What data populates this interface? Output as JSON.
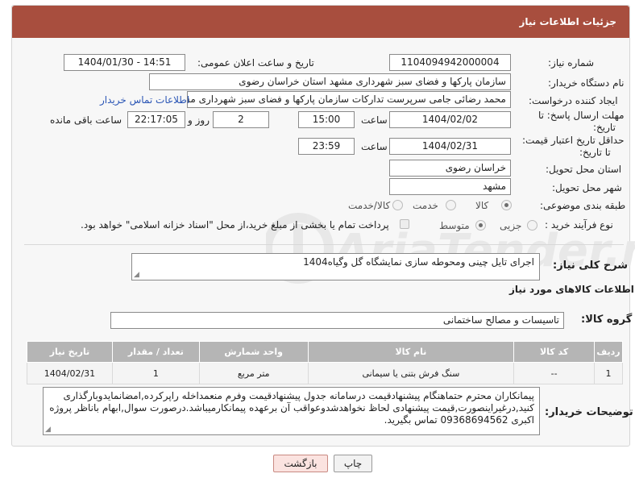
{
  "header": {
    "title": "جزئیات اطلاعات نیاز"
  },
  "fields": {
    "need_number": {
      "label": "شماره نیاز:",
      "value": "1104094942000004"
    },
    "announce_date": {
      "label": "تاریخ و ساعت اعلان عمومی:",
      "value": "1404/01/30 - 14:51"
    },
    "buyer_org": {
      "label": "نام دستگاه خریدار:",
      "value": "سازمان پارکها و فضای سبز شهرداری مشهد استان خراسان رضوی"
    },
    "creator": {
      "label": "ایجاد کننده درخواست:",
      "value": "محمد رضائی جامی سرپرست تدارکات سازمان پارکها و فضای سبز شهرداری مش",
      "contact_link": "اطلاعات تماس خریدار"
    },
    "deadline": {
      "label_line1": "مهلت ارسال پاسخ: تا",
      "label_line2": "تاریخ:",
      "date": "1404/02/02",
      "time_label": "ساعت",
      "time": "15:00",
      "days": "2",
      "days_label": "روز و",
      "remaining": "22:17:05",
      "remaining_label": "ساعت باقی مانده"
    },
    "price_validity": {
      "label_line1": "حداقل تاریخ اعتبار قیمت:",
      "label_line2": "تا تاریخ:",
      "date": "1404/02/31",
      "time_label": "ساعت",
      "time": "23:59"
    },
    "province": {
      "label": "استان محل تحویل:",
      "value": "خراسان رضوی"
    },
    "city": {
      "label": "شهر محل تحویل:",
      "value": "مشهد"
    },
    "category": {
      "label": "طبقه بندی موضوعی:",
      "options": [
        "کالا",
        "خدمت",
        "کالا/خدمت"
      ],
      "selected": "کالا"
    },
    "process_type": {
      "label": "نوع فرآیند خرید :",
      "options": [
        "جزیی",
        "متوسط"
      ],
      "selected": "متوسط",
      "payment_note": "پرداخت تمام یا بخشی از مبلغ خرید،از محل \"اسناد خزانه اسلامی\" خواهد بود."
    }
  },
  "description": {
    "label": "شرح کلی نیاز:",
    "value": "اجرای تایل چینی ومحوطه سازی نمایشگاه گل وگیاه1404"
  },
  "goods_section": {
    "title": "اطلاعات کالاهای مورد نیاز",
    "group_label": "گروه کالا:",
    "group_value": "تاسیسات و مصالح ساختمانی",
    "columns": [
      "ردیف",
      "کد کالا",
      "نام کالا",
      "واحد شمارش",
      "تعداد / مقدار",
      "تاریخ نیاز"
    ],
    "rows": [
      [
        "1",
        "--",
        "سنگ فرش بتنی یا سیمانی",
        "متر مربع",
        "1",
        "1404/02/31"
      ]
    ]
  },
  "buyer_notes": {
    "label": "توضیحات خریدار:",
    "value": "پیمانکاران محترم حتماهنگام پیشنهادقیمت درسامانه جدول پیشنهادقیمت وفرم منعمداخله راپرکرده,امضانمایدوبارگذاری کنید,درغیراینصورت,قیمت پیشنهادی لحاظ نخواهدشدوعواقب آن برعهده پیمانکارمیباشد.درصورت سوال,ابهام باناظر پروژه اکبری 09368694562 تماس بگیرید."
  },
  "buttons": {
    "print": "چاپ",
    "back": "بازگشت"
  },
  "watermark": {
    "text": "AriaTender.net"
  },
  "colors": {
    "header": "#a84e3e",
    "table_header": "#b5b5b5",
    "link": "#2a55b5",
    "back_button": "#fbe3e0"
  }
}
